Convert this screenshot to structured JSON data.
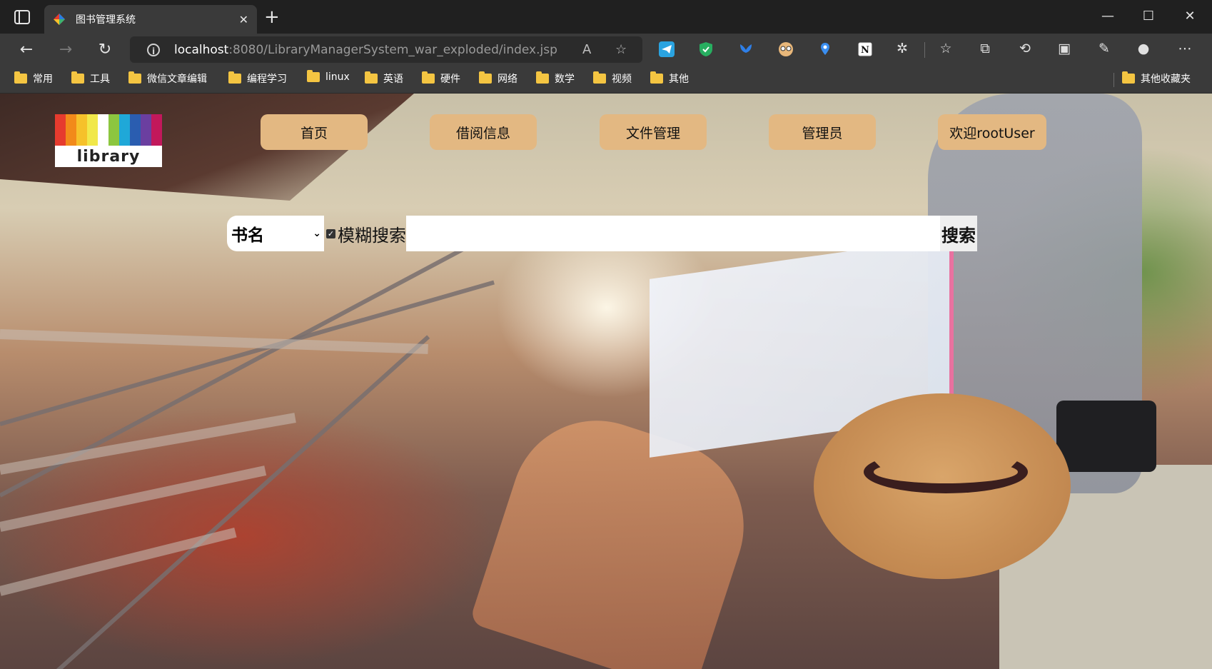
{
  "browser": {
    "tab_title": "图书管理系统",
    "tab_close": "✕",
    "new_tab": "+",
    "url_host": "localhost",
    "url_rest": ":8080/LibraryManagerSystem_war_exploded/index.jsp",
    "window_controls": {
      "minimize": "—",
      "maximize": "☐",
      "close": "✕"
    },
    "nav": {
      "back": "←",
      "forward": "→",
      "reload": "↻"
    },
    "bookmarks": [
      "常用",
      "工具",
      "微信文章编辑",
      "编程学习",
      "linux",
      "英语",
      "硬件",
      "网络",
      "数学",
      "视频",
      "其他"
    ],
    "bookmarks_other": "其他收藏夹"
  },
  "page": {
    "logo_text": "library",
    "logo_colors": [
      "#e63b2e",
      "#f28a1a",
      "#f6c12a",
      "#f1e84a",
      "#ffffff",
      "#8cc63f",
      "#1fa8d8",
      "#2a5db0",
      "#6b3fa0",
      "#c2185b"
    ],
    "nav_buttons": [
      "首页",
      "借阅信息",
      "文件管理",
      "管理员",
      "欢迎rootUser"
    ],
    "search": {
      "field_selected": "书名",
      "fuzzy_checked": true,
      "fuzzy_label": "模糊搜索",
      "input_value": "",
      "button_label": "搜索"
    }
  },
  "colors": {
    "nav_button_bg": "#e3b882",
    "chrome_dark": "#202020",
    "chrome_toolbar": "#3a3a3a"
  }
}
